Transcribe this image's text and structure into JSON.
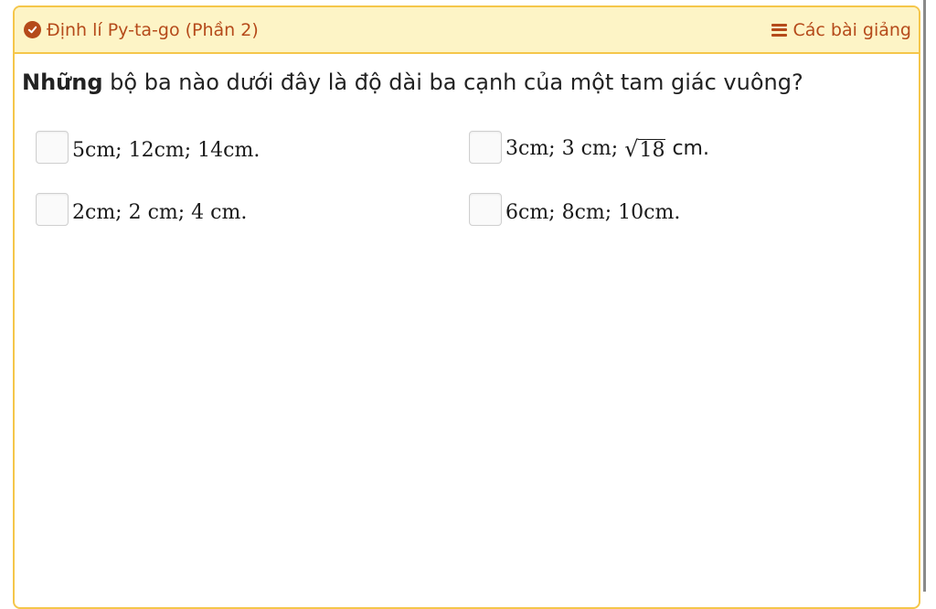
{
  "header": {
    "lesson_title": "Định lí Py-ta-go (Phần 2)",
    "lessons_link": "Các bài giảng",
    "accent_color": "#b54a1a",
    "background_color": "#fdf4c6",
    "border_color": "#f5c64a",
    "icons": {
      "title_icon": "check-circle-icon",
      "lessons_icon": "menu-icon"
    }
  },
  "question": {
    "bold_prefix": "Những",
    "text": " bộ ba nào dưới đây là độ dài ba cạnh của một tam giác vuông?"
  },
  "options": [
    {
      "text": "5cm; 12cm; 14cm.",
      "checked": false
    },
    {
      "text_before": "3cm; 3 cm; ",
      "sqrt_symbol": "√",
      "radicand": "18",
      "text_after": " cm.",
      "checked": false
    },
    {
      "text": "2cm; 2 cm; 4 cm.",
      "checked": false
    },
    {
      "text": "6cm; 8cm; 10cm.",
      "checked": false
    }
  ]
}
